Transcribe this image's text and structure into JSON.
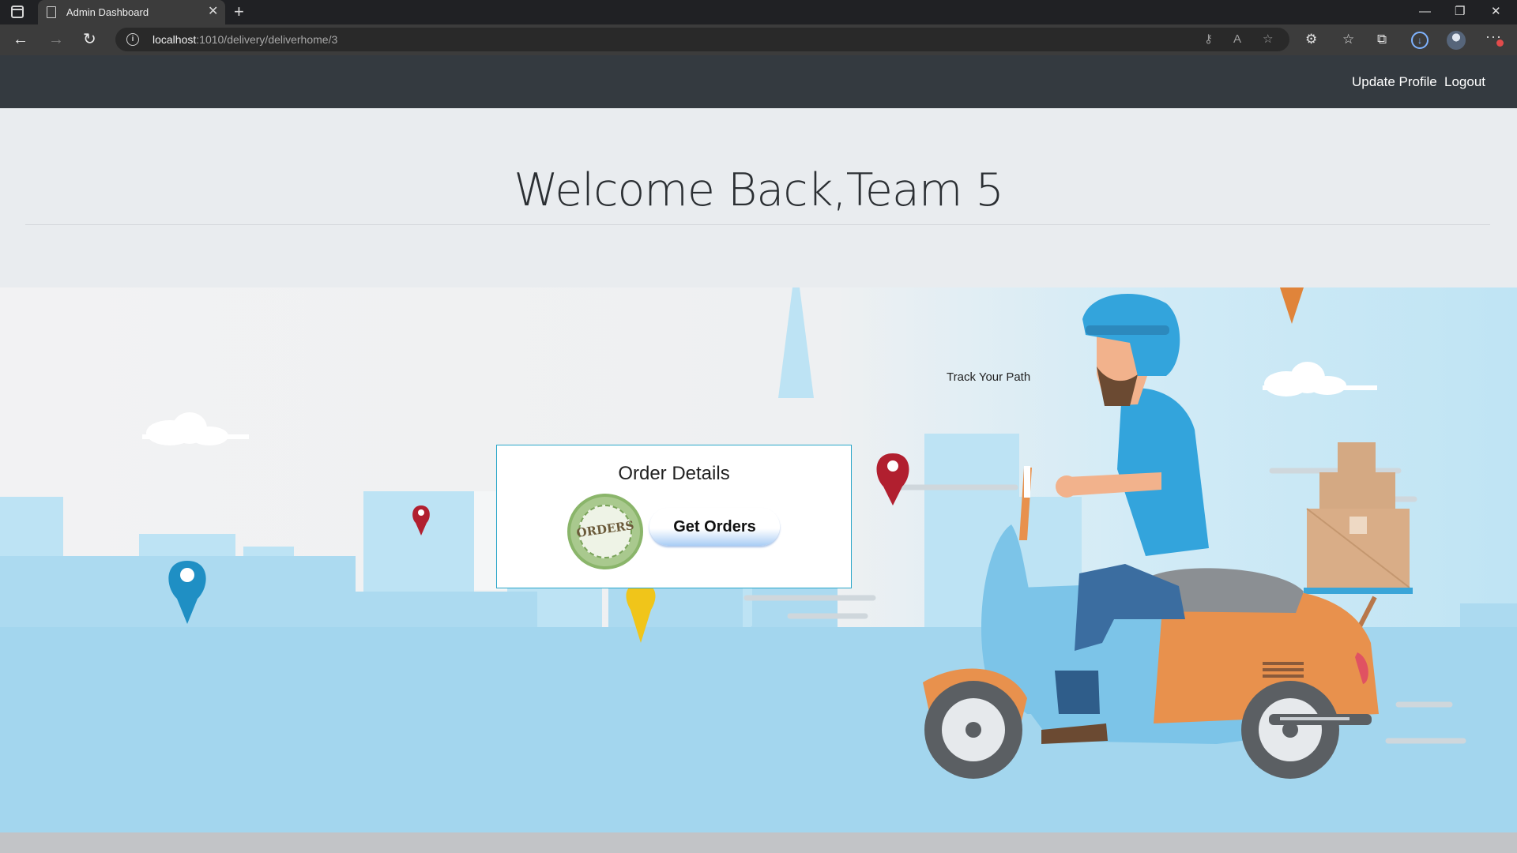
{
  "browser": {
    "tab_title": "Admin Dashboard",
    "url_host": "localhost",
    "url_path": ":1010/delivery/deliverhome/3"
  },
  "navbar": {
    "update_profile": "Update Profile",
    "logout": "Logout"
  },
  "jumbotron": {
    "welcome": "Welcome Back,Team 5"
  },
  "scene": {
    "track_label": "Track Your Path"
  },
  "order_card": {
    "title": "Order Details",
    "stamp_text": "ORDERS",
    "button_label": "Get Orders"
  },
  "colors": {
    "navbar_bg": "#343a40",
    "jumbotron_bg": "#e9ecef",
    "card_border": "#2aa6c9",
    "sky_blue": "#a9dcf2"
  }
}
